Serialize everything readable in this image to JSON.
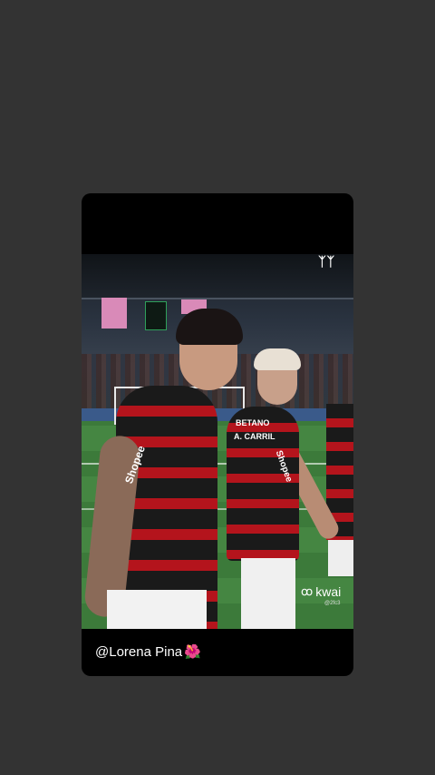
{
  "overlay": {
    "corner_logo": "ᛉᛉ",
    "watermark": {
      "label": "kwai",
      "icon": "kwai-logo-icon",
      "handle": "@2fc3"
    }
  },
  "jersey": {
    "main_sponsor": "Shopee",
    "second_sponsor": "BETANO",
    "second_name": "A. CARRIL",
    "second_side": "Shopee"
  },
  "caption": {
    "text": "@Lorena Pina",
    "emoji": "🌺"
  },
  "colors": {
    "background": "#333333",
    "card": "#000000",
    "jersey_red": "#b4141c"
  }
}
